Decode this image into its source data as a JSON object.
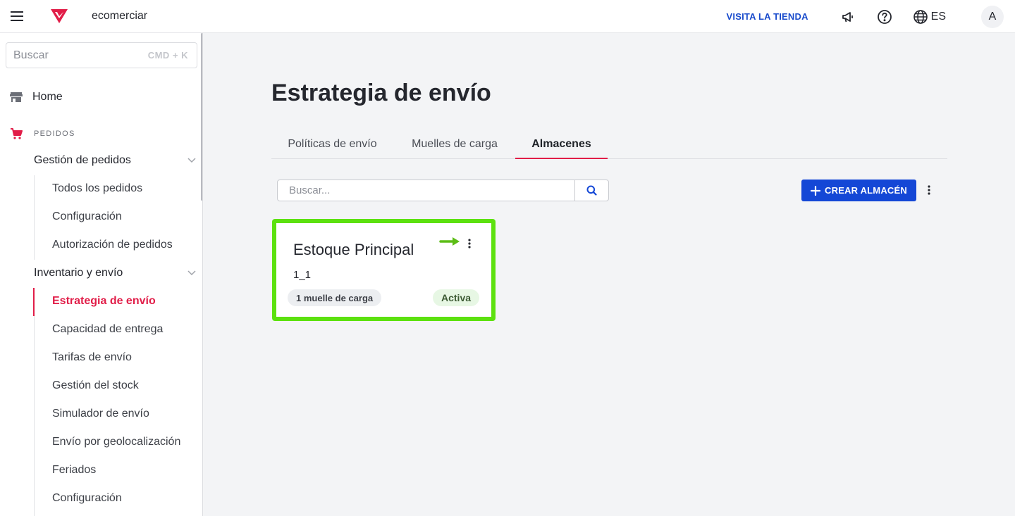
{
  "header": {
    "store_name": "ecomerciar",
    "visit_store": "VISITA LA TIENDA",
    "language": "ES",
    "avatar_initial": "A",
    "brand_color": "#e11d48"
  },
  "sidebar": {
    "search_placeholder": "Buscar",
    "search_shortcut": "CMD + K",
    "home_label": "Home",
    "section_label": "PEDIDOS",
    "groups": [
      {
        "label": "Gestión de pedidos",
        "items": [
          "Todos los pedidos",
          "Configuración",
          "Autorización de pedidos"
        ]
      },
      {
        "label": "Inventario y envío",
        "items": [
          "Estrategia de envío",
          "Capacidad de entrega",
          "Tarifas de envío",
          "Gestión del stock",
          "Simulador de envío",
          "Envío por geolocalización",
          "Feriados",
          "Configuración"
        ]
      }
    ],
    "active_item": "Estrategia de envío"
  },
  "main": {
    "title": "Estrategia de envío",
    "tabs": [
      {
        "label": "Políticas de envío",
        "active": false
      },
      {
        "label": "Muelles de carga",
        "active": false
      },
      {
        "label": "Almacenes",
        "active": true
      }
    ],
    "search_placeholder": "Buscar...",
    "create_button": "CREAR ALMACÉN",
    "primary_color": "#1447d6"
  },
  "warehouse_card": {
    "name": "Estoque Principal",
    "code": "1_1",
    "docks_badge": "1 muelle de carga",
    "status": "Activa",
    "highlight_color": "#5ce10f"
  }
}
